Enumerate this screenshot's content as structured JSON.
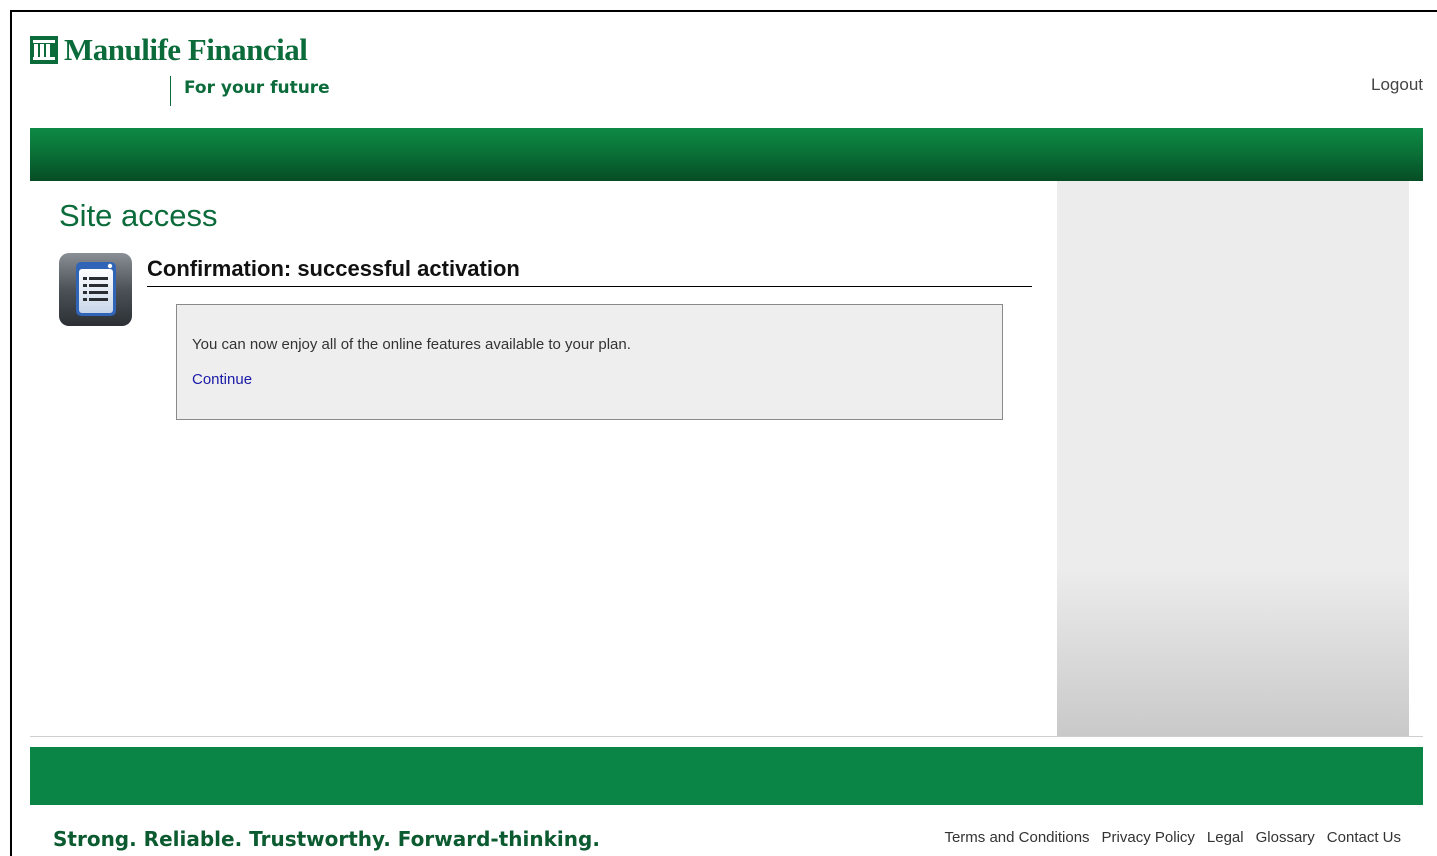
{
  "header": {
    "logo_name": "Manulife Financial",
    "tagline": "For your future",
    "logout_label": "Logout"
  },
  "main": {
    "page_title": "Site access",
    "section_heading": "Confirmation: successful activation",
    "message": "You can now enjoy all of the online features available to your plan.",
    "continue_label": "Continue"
  },
  "footer": {
    "slogan": "Strong. Reliable. Trustworthy. Forward-thinking.",
    "links": [
      {
        "label": "Terms and Conditions"
      },
      {
        "label": "Privacy Policy"
      },
      {
        "label": "Legal"
      },
      {
        "label": "Glossary"
      },
      {
        "label": "Contact Us"
      }
    ]
  },
  "colors": {
    "brand_green": "#0b6b3a",
    "band_green": "#0b8545",
    "link_blue": "#1a1aa6"
  }
}
